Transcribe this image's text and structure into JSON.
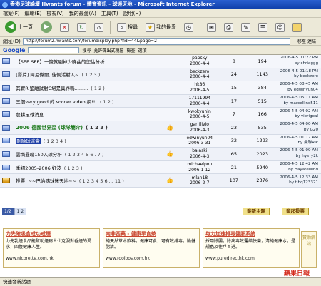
{
  "window": {
    "title": "香港足球論壇 Hwants forum - 體育資訊 - 球迷天地 - Microsoft Internet Explorer"
  },
  "menu": [
    "檔案(F)",
    "編輯(E)",
    "檢視(V)",
    "我的最愛(A)",
    "工具(T)",
    "說明(H)"
  ],
  "toolbar": {
    "back": "上一頁",
    "search": "搜尋",
    "favorites": "我的最愛"
  },
  "address": {
    "label": "網址(D)",
    "url": "http://forum2.hwants.com/forumdisplay.php?fid=44&page=2",
    "go": "移至 連結"
  },
  "google": {
    "logo": "Google",
    "search": "搜尋",
    "popups": "允許彈出式視窗",
    "check": "檢查",
    "options": "選項"
  },
  "threads": [
    {
      "title": "【SEE SEE】一簽就剔掉少睇曲的您估分析",
      "pages": "",
      "author": "papsky",
      "date": "2006-4-4",
      "replies": "8",
      "views": "194",
      "last_time": "2006-4-5 01:22 PM",
      "last_by": "by chriaggg",
      "style": "normal"
    },
    {
      "title": "[影片] 阿尼傑爾, 佳侯活射入~",
      "pages": "( 1 2 3 )",
      "author": "beckzero",
      "date": "2006-4-4",
      "replies": "24",
      "views": "1143",
      "last_time": "2006-4-5 01:18 PM",
      "last_by": "by beckzero",
      "style": "normal"
    },
    {
      "title": "其實R.堅離試射C堪是具界嗎.........",
      "pages": "( 1 2 )",
      "author": "hk86",
      "date": "2006-4-5",
      "replies": "15",
      "views": "384",
      "last_time": "2006-4-5 08:45 AM",
      "last_by": "by edwinyun04",
      "style": "normal"
    },
    {
      "title": "三個very good 的 soccer video 網!!!",
      "pages": "( 1 2 )",
      "author": "17111994",
      "date": "2006-4-4",
      "replies": "17",
      "views": "515",
      "last_by": "by marcellino511",
      "last_time": "2006-4-5 05:11 AM",
      "style": "normal"
    },
    {
      "title": "農耕足球消息",
      "pages": "",
      "author": "kwokyuhin",
      "date": "2006-4-5",
      "replies": "7",
      "views": "166",
      "last_time": "2006-4-5 04:02 AM",
      "last_by": "by vierigoal",
      "style": "normal"
    },
    {
      "title": "2006 德國世界盃 (球隊簡介)",
      "pages": "( 1 2 3 )",
      "author": "garrilivio",
      "date": "2006-4-3",
      "replies": "23",
      "views": "535",
      "last_time": "2006-4-5 04:00 AM",
      "last_by": "by G20",
      "style": "green"
    },
    {
      "title": "刪除球迷會",
      "pages": "( 1 2 3 4 )",
      "author": "edwinyun04",
      "date": "2006-3-31",
      "replies": "32",
      "views": "1293",
      "last_time": "2006-4-5 01:17 AM",
      "last_by": "by 曼聯Rik",
      "style": "highlight"
    },
    {
      "title": "雲尚曼聯150入球分析",
      "pages": "( 1 2 3 4 5 6 . 7 )",
      "author": "balaski",
      "date": "2006-4-3",
      "replies": "65",
      "views": "2023",
      "last_time": "2006-4-5 01:09 AM",
      "last_by": "by hys_y2k",
      "style": "normal"
    },
    {
      "title": "季初2005-2006 好波",
      "pages": "( 1 2 3 )",
      "author": "michaelpop",
      "date": "2006-1-12",
      "replies": "21",
      "views": "5940",
      "last_time": "2006-4-5 12:42 AM",
      "last_by": "by Hayatewind",
      "style": "normal"
    },
    {
      "title": "投票: ~~巴治病球迷天地~~",
      "pages": "( 1 2 3 4 5 6 ... 11 )",
      "author": "mlan18",
      "date": "2006-2-7",
      "replies": "107",
      "views": "2376",
      "last_time": "2006-4-5 12:33 AM",
      "last_by": "by tibq123321",
      "style": "poll"
    }
  ],
  "pagination": {
    "current": "1/2",
    "pages": "1  2"
  },
  "buttons": {
    "new_thread": "發新主題",
    "new_poll": "發起投票"
  },
  "ads": [
    {
      "title": "力先確吸食成功戒煙",
      "text": "力先乳煙食品能幫助煙癮人仕克服對香煙的渴求，回復健康人生。",
      "url": "www.nicorette.com.hk"
    },
    {
      "title": "南非西藥 - 健康早食茶",
      "text": "純天然草本飲料，健康可食，可有效排毒，脆健脂清。",
      "url": "www.rooibos.com.hk"
    },
    {
      "title": "每力加速排毒健肝系統",
      "text": "採用除腸，除病毒效運結快樂，清純健康水，是規蟲及住戶首選。",
      "url": "www.puredirecthk.com"
    }
  ],
  "ad_side": "贊助網站",
  "status": "快速發新話題",
  "watermark": "蘋果日報"
}
